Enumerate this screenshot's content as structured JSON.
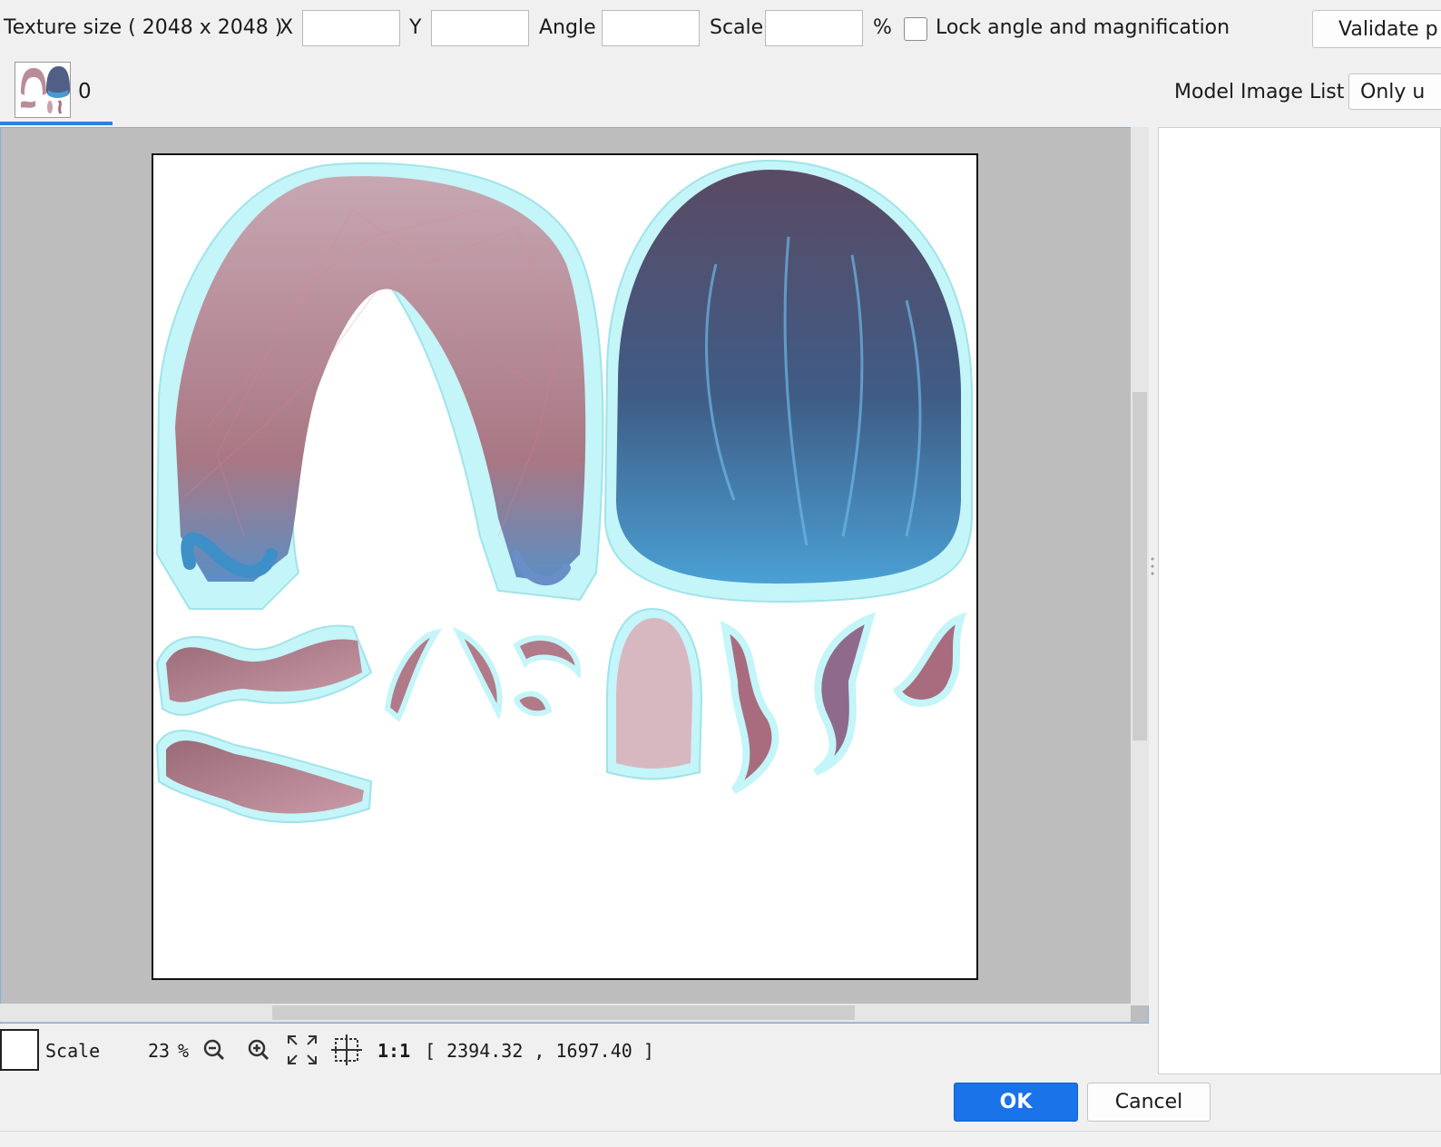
{
  "toolbar": {
    "texture_size_label": "Texture size ( 2048 x 2048 )",
    "x_label": "X",
    "x_value": "",
    "y_label": "Y",
    "y_value": "",
    "angle_label": "Angle",
    "angle_value": "",
    "scale_label": "Scale",
    "scale_value": "",
    "percent_label": "%",
    "lock_label": "Lock angle and magnification",
    "lock_checked": false,
    "validate_label": "Validate p"
  },
  "tabs": [
    {
      "label": "0",
      "selected": true
    }
  ],
  "model_image_list": {
    "label": "Model Image List",
    "filter_value": "Only u"
  },
  "bottom": {
    "scale_label": "Scale",
    "zoom_value": "23",
    "zoom_unit": "%",
    "one_to_one_label": "1:1",
    "coordinates": "[ 2394.32 , 1697.40 ]"
  },
  "dialog": {
    "ok_label": "OK",
    "cancel_label": "Cancel"
  },
  "colors": {
    "accent": "#1a73e8",
    "hair_pink": "#b98c98",
    "hair_blue": "#4a8fc2",
    "mesh_halo": "#bff4f7"
  }
}
